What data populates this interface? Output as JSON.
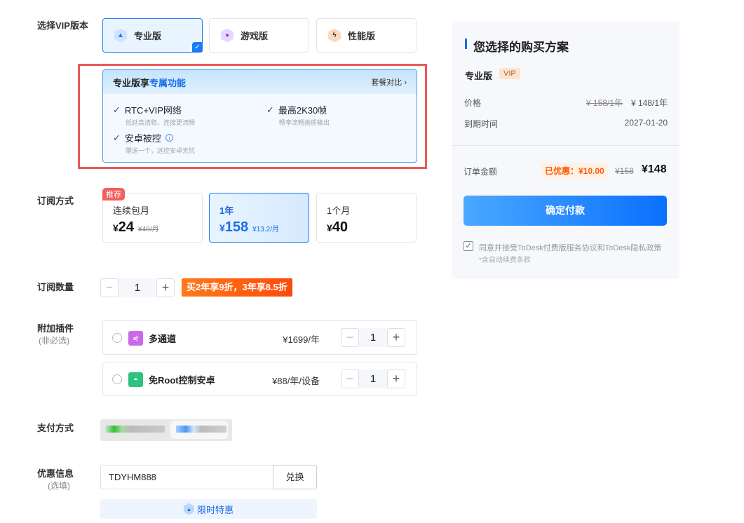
{
  "labels": {
    "version": "选择VIP版本",
    "subscription": "订阅方式",
    "quantity": "订阅数量",
    "addons": "附加插件",
    "addons_note": "(非必选)",
    "payment": "支付方式",
    "coupon": "优惠信息",
    "coupon_note": "(选填)"
  },
  "versions": [
    {
      "label": "专业版",
      "icon": "a"
    },
    {
      "label": "游戏版",
      "icon": "gamepad"
    },
    {
      "label": "性能版",
      "icon": "bolt"
    }
  ],
  "features": {
    "title_prefix": "专业版享",
    "title_highlight": "专属功能",
    "compare": "套餐对比",
    "items": [
      {
        "title": "RTC+VIP网络",
        "desc": "低延高清稳，连接更流畅"
      },
      {
        "title": "最高2K30帧",
        "desc": "畅享流畅画质输出"
      },
      {
        "title": "安卓被控",
        "desc": "赠送一个，远控安卓无忧"
      }
    ]
  },
  "plans": [
    {
      "badge": "推荐",
      "name": "连续包月",
      "currency": "¥",
      "price": "24",
      "orig": "¥40/月"
    },
    {
      "name": "1年",
      "currency": "¥",
      "price": "158",
      "orig": "¥13.2/月"
    },
    {
      "name": "1个月",
      "currency": "¥",
      "price": "40"
    }
  ],
  "quantity": {
    "value": "1",
    "minus": "−",
    "plus": "+",
    "promo": "买2年享9折，3年享8.5折"
  },
  "addons": [
    {
      "name": "多通道",
      "price": "¥1699/年",
      "qty": "1",
      "color": "#c86ae8"
    },
    {
      "name": "免Root控制安卓",
      "price": "¥88/年/设备",
      "qty": "1",
      "color": "#2ec27e"
    }
  ],
  "coupon": {
    "value": "TDYHM888",
    "button": "兑换",
    "offer": "限时特惠"
  },
  "summary": {
    "title": "您选择的购买方案",
    "edition": "专业版",
    "badge": "VIP",
    "price_label": "价格",
    "price_orig": "¥ 158/1年",
    "price_now": "¥ 148/1年",
    "expire_label": "到期时间",
    "expire": "2027-01-20",
    "total_label": "订单金额",
    "discount": "已优惠：¥10.00",
    "total_orig": "¥158",
    "total": "¥148",
    "pay": "确定付款",
    "agree": "同意并接受ToDesk付费版服务协议和ToDesk隐私政策",
    "agree_note": "*含自动续费条款"
  }
}
